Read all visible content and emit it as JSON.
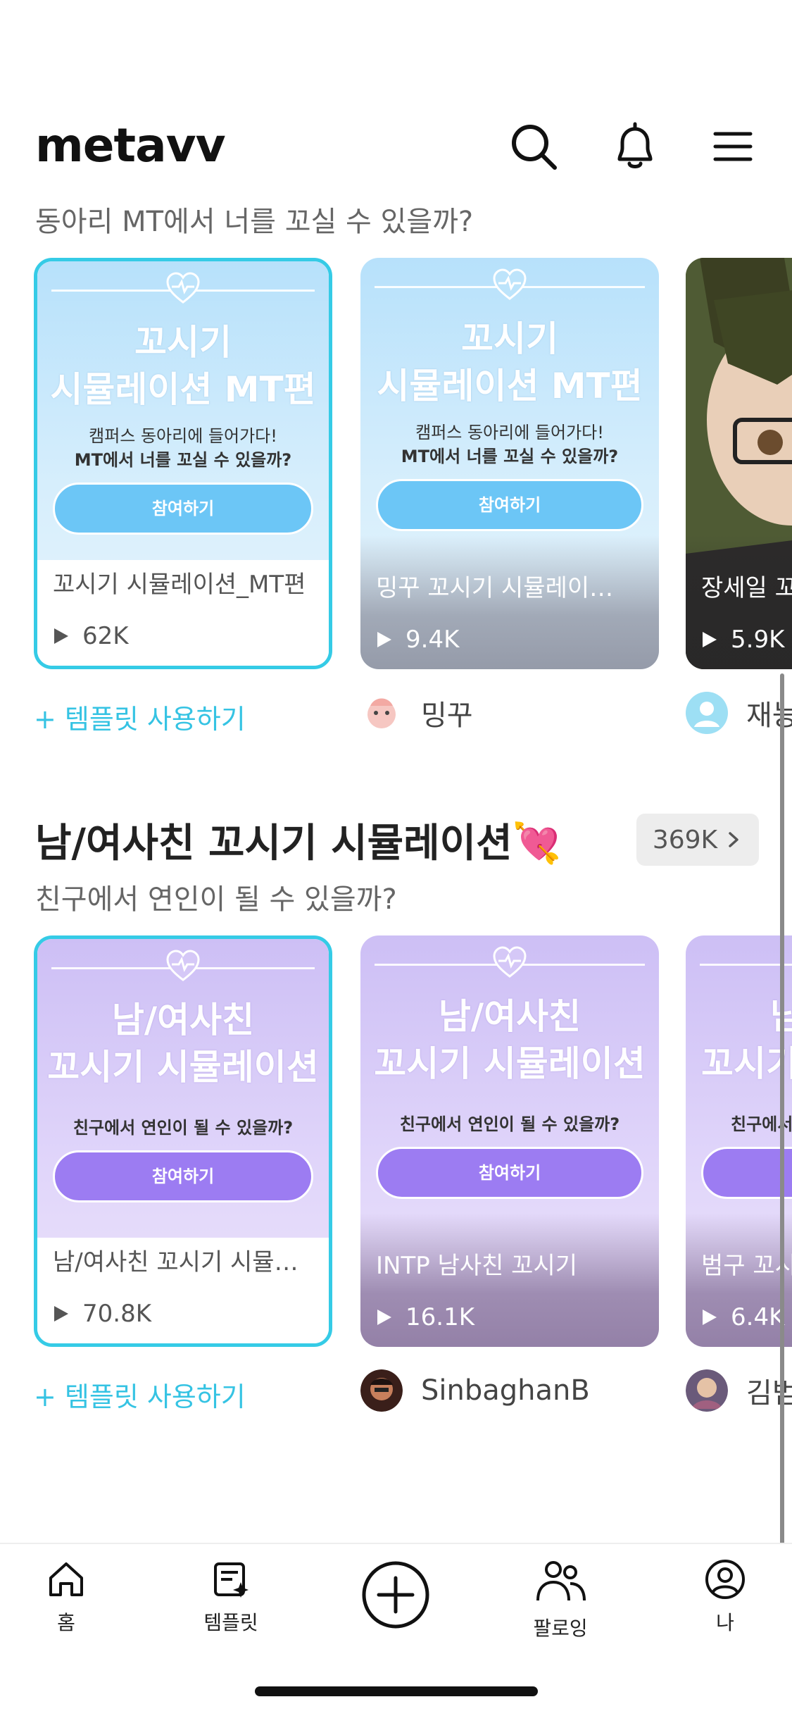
{
  "app": {
    "logo": "metavv"
  },
  "header": {
    "search_icon": "search-icon",
    "bell_icon": "bell-icon",
    "menu_icon": "menu-icon"
  },
  "section1": {
    "subtitle": "동아리 MT에서 너를 꼬실 수 있을까?",
    "cards": [
      {
        "poster_title_1": "꼬시기",
        "poster_title_2": "시뮬레이션 MT편",
        "poster_sub_1": "캠퍼스 동아리에 들어가다!",
        "poster_sub_2": "MT에서 너를 꼬실 수 있을까?",
        "cta": "참여하기",
        "title": "꼬시기 시뮬레이션_MT편",
        "views": "62K"
      },
      {
        "poster_title_1": "꼬시기",
        "poster_title_2": "시뮬레이션 MT편",
        "poster_sub_1": "캠퍼스 동아리에 들어가다!",
        "poster_sub_2": "MT에서 너를 꼬실 수 있을까?",
        "cta": "참여하기",
        "title": "밍꾸 꼬시기 시뮬레이…",
        "views": "9.4K"
      },
      {
        "title": "장세일 꼬",
        "views": "5.9K"
      }
    ],
    "use_template": "+ 템플릿 사용하기",
    "authors": [
      "밍꾸",
      "재능"
    ]
  },
  "section2": {
    "title": "남/여사친 꼬시기 시뮬레이션💘",
    "count": "369K",
    "subtitle": "친구에서 연인이 될 수 있을까?",
    "cards": [
      {
        "poster_title_1": "남/여사친",
        "poster_title_2": "꼬시기 시뮬레이션",
        "poster_sub_1": "친구에서 연인이 될 수 있을까?",
        "cta": "참여하기",
        "title": "남/여사친 꼬시기 시뮬…",
        "views": "70.8K"
      },
      {
        "poster_title_1": "남/여사친",
        "poster_title_2": "꼬시기 시뮬레이션",
        "poster_sub_1": "친구에서 연인이 될 수 있을까?",
        "cta": "참여하기",
        "title": "INTP 남사친 꼬시기",
        "views": "16.1K"
      },
      {
        "poster_title_1": "남/",
        "poster_title_2": "꼬시기",
        "poster_sub_1": "친구에서",
        "cta": "",
        "title": "범구 꼬시",
        "views": "6.4K"
      }
    ],
    "use_template": "+ 템플릿 사용하기",
    "authors": [
      "SinbaghanB",
      "김범"
    ]
  },
  "nav": {
    "items": [
      {
        "label": "홈",
        "icon": "home-icon"
      },
      {
        "label": "템플릿",
        "icon": "template-icon"
      },
      {
        "label": "",
        "icon": "plus-circle-icon"
      },
      {
        "label": "팔로잉",
        "icon": "people-icon"
      },
      {
        "label": "나",
        "icon": "profile-icon"
      }
    ]
  },
  "colors": {
    "accent": "#35cbe6",
    "link": "#35c3e3",
    "blue_cta": "#6cc6f6",
    "purple_cta": "#9c7cf2"
  }
}
